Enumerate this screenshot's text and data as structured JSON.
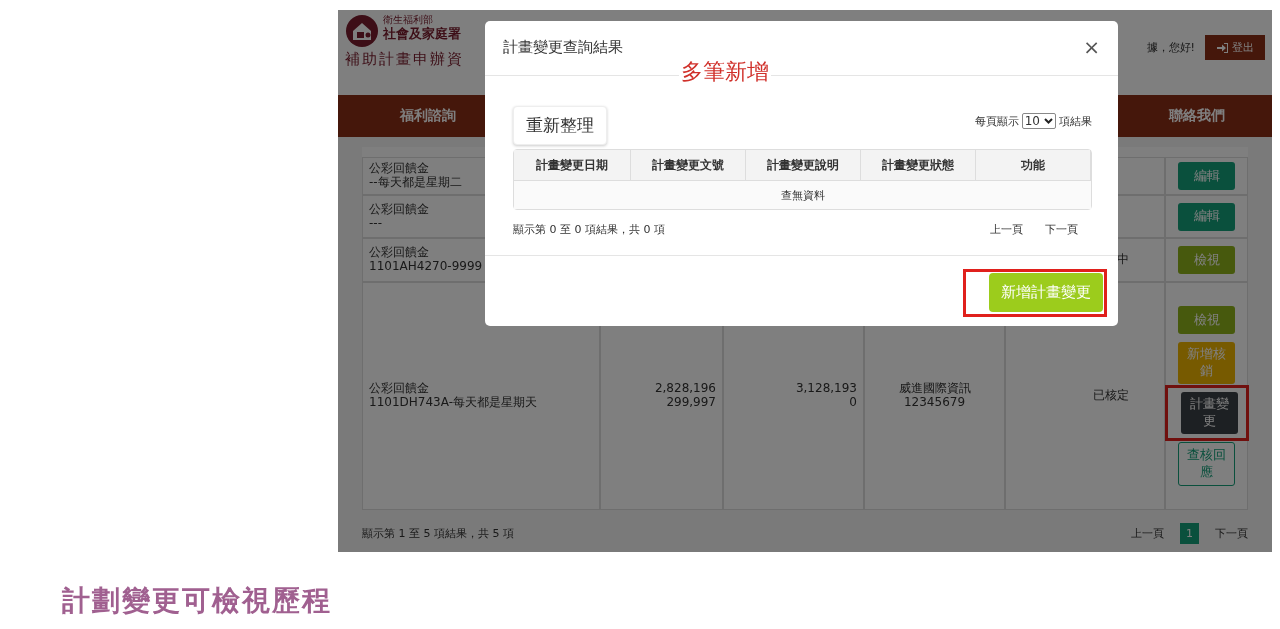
{
  "page": {
    "header": {
      "agency": "衛生福利部",
      "department": "社會及家庭署",
      "site_title": "補助計畫申辦資",
      "greeting": "據，您好!",
      "logout": "登出"
    },
    "nav": [
      "福利諮詢",
      "聯絡我們"
    ],
    "table": {
      "rows": [
        {
          "name": [
            "公彩回饋金",
            "--每天都是星期二"
          ],
          "actions": [
            {
              "label": "編輯",
              "kind": "edit",
              "highlighted": false
            }
          ]
        },
        {
          "name": [
            "公彩回饋金",
            "---"
          ],
          "actions": [
            {
              "label": "編輯",
              "kind": "edit",
              "highlighted": false
            }
          ]
        },
        {
          "name": [
            "公彩回饋金",
            "1101AH4270-9999"
          ],
          "status": [
            "中"
          ],
          "actions": [
            {
              "label": "檢視",
              "kind": "view",
              "highlighted": false
            }
          ]
        },
        {
          "name": [
            "公彩回饋金",
            "1101DH743A-每天都是星期天"
          ],
          "amount_1": [
            "2,828,196",
            "299,997"
          ],
          "amount_2": [
            "3,128,193",
            "0"
          ],
          "company": [
            "威進國際資訊",
            "12345679"
          ],
          "status": [
            "已核定"
          ],
          "actions": [
            {
              "label": "檢視",
              "kind": "view",
              "highlighted": false
            },
            {
              "label": "新增核銷",
              "kind": "write_off",
              "highlighted": false
            },
            {
              "label": "計畫變更",
              "kind": "change",
              "highlighted": true
            },
            {
              "label": "查核回應",
              "kind": "outline",
              "highlighted": false
            }
          ]
        }
      ]
    },
    "footer": {
      "summary": "顯示第 1 至 5 項結果，共 5 項",
      "pagination": [
        {
          "label": "上一頁",
          "selected": false
        },
        {
          "label": "1",
          "selected": true
        },
        {
          "label": "下一頁",
          "selected": false
        }
      ]
    }
  },
  "modal": {
    "title": "計畫變更查詢結果",
    "close": "×",
    "refresh": "重新整理",
    "page_size": {
      "before": "每頁顯示",
      "value": "10",
      "after": "項結果"
    },
    "columns": [
      "計畫變更日期",
      "計畫變更文號",
      "計畫變更說明",
      "計畫變更狀態",
      "功能"
    ],
    "empty": "查無資料",
    "summary": "顯示第 0 至 0 項結果，共 0 項",
    "pagination": [
      "上一頁",
      "下一頁"
    ],
    "add_button": {
      "label": "新增計畫變更",
      "highlighted": true
    }
  },
  "annotation": "多筆新增",
  "caption": "計劃變更可檢視歷程"
}
